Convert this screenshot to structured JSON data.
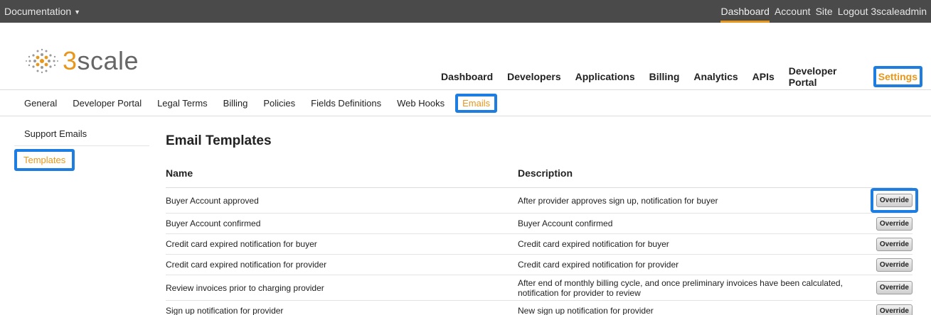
{
  "topbar": {
    "documentation_label": "Documentation",
    "links": [
      {
        "label": "Dashboard",
        "active": true
      },
      {
        "label": "Account",
        "active": false
      },
      {
        "label": "Site",
        "active": false
      },
      {
        "label": "Logout 3scaleadmin",
        "active": false
      }
    ]
  },
  "logo": {
    "number": "3",
    "word": "scale"
  },
  "main_nav": [
    "Dashboard",
    "Developers",
    "Applications",
    "Billing",
    "Analytics",
    "APIs",
    "Developer Portal",
    "Settings"
  ],
  "main_nav_active": "Settings",
  "sub_nav": [
    "General",
    "Developer Portal",
    "Legal Terms",
    "Billing",
    "Policies",
    "Fields Definitions",
    "Web Hooks",
    "Emails"
  ],
  "sub_nav_active": "Emails",
  "sidebar": [
    "Support Emails",
    "Templates"
  ],
  "sidebar_active": "Templates",
  "content": {
    "title": "Email Templates",
    "columns": {
      "name": "Name",
      "description": "Description"
    },
    "button_label": "Override",
    "rows": [
      {
        "name": "Buyer Account approved",
        "description": "After provider approves sign up, notification for buyer"
      },
      {
        "name": "Buyer Account confirmed",
        "description": "Buyer Account confirmed"
      },
      {
        "name": "Credit card expired notification for buyer",
        "description": "Credit card expired notification for buyer"
      },
      {
        "name": "Credit card expired notification for provider",
        "description": "Credit card expired notification for provider"
      },
      {
        "name": "Review invoices prior to charging provider",
        "description": "After end of monthly billing cycle, and once preliminary invoices have been calculated, notification for provider to review"
      },
      {
        "name": "Sign up notification for provider",
        "description": "New sign up notification for provider"
      }
    ]
  },
  "colors": {
    "accent": "#e8971b",
    "highlight": "#1e7de0",
    "topbar": "#4a4a4a"
  }
}
